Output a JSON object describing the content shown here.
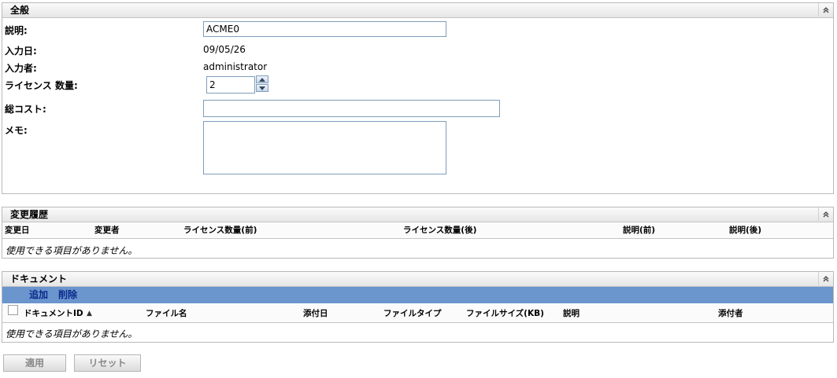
{
  "general": {
    "title": "全般",
    "description_label": "説明:",
    "description_value": "ACME0",
    "entered_date_label": "入力日:",
    "entered_date_value": "09/05/26",
    "entered_by_label": "入力者:",
    "entered_by_value": "administrator",
    "license_qty_label": "ライセンス 数量:",
    "license_qty_value": "2",
    "total_cost_label": "総コスト:",
    "total_cost_value": "",
    "memo_label": "メモ:",
    "memo_value": ""
  },
  "history": {
    "title": "変更履歴",
    "columns": [
      "変更日",
      "変更者",
      "ライセンス数量(前)",
      "ライセンス数量(後)",
      "説明(前)",
      "説明(後)"
    ],
    "empty_text": "使用できる項目がありません。"
  },
  "documents": {
    "title": "ドキュメント",
    "add_label": "追加",
    "delete_label": "削除",
    "columns": [
      "ドキュメントID",
      "ファイル名",
      "添付日",
      "ファイルタイプ",
      "ファイルサイズ(KB)",
      "説明",
      "添付者"
    ],
    "empty_text": "使用できる項目がありません。"
  },
  "actions": {
    "apply_label": "適用",
    "reset_label": "リセット"
  }
}
